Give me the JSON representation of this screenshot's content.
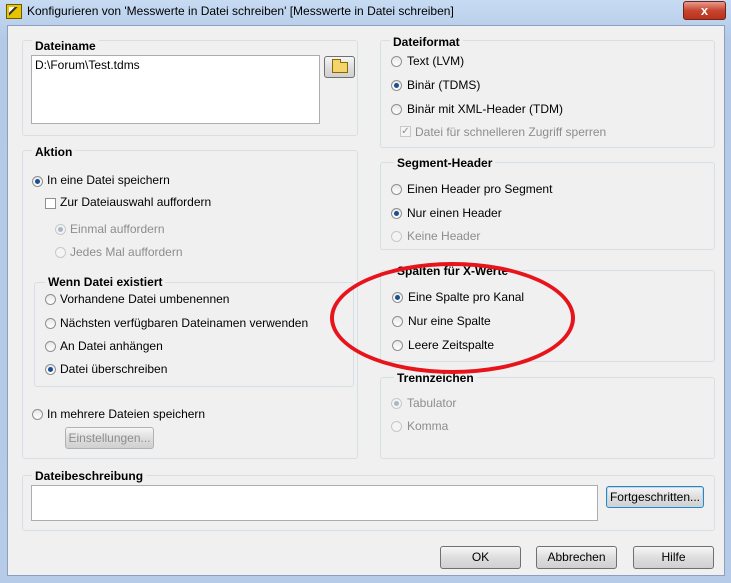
{
  "window": {
    "title": "Konfigurieren von 'Messwerte in Datei schreiben' [Messwerte in Datei schreiben]",
    "close_symbol": "x"
  },
  "dateiname": {
    "label": "Dateiname",
    "value": "D:\\Forum\\Test.tdms"
  },
  "aktion": {
    "label": "Aktion",
    "single_file": "In eine Datei speichern",
    "ask_checkbox": "Zur Dateiauswahl auffordern",
    "ask_once": "Einmal auffordern",
    "ask_each": "Jedes Mal auffordern",
    "multi_files": "In mehrere Dateien speichern",
    "settings_button": "Einstellungen..."
  },
  "wenn_datei": {
    "label": "Wenn Datei existiert",
    "options": [
      "Vorhandene Datei umbenennen",
      "Nächsten verfügbaren Dateinamen verwenden",
      "An Datei anhängen",
      "Datei überschreiben"
    ]
  },
  "dateiformat": {
    "label": "Dateiformat",
    "options": [
      "Text (LVM)",
      "Binär (TDMS)",
      "Binär mit XML-Header (TDM)"
    ],
    "lock_checkbox": "Datei für schnelleren Zugriff sperren",
    "check_mark": "✓"
  },
  "segment_header": {
    "label": "Segment-Header",
    "options": [
      "Einen Header pro Segment",
      "Nur einen Header",
      "Keine Header"
    ]
  },
  "spalten": {
    "label": "Spalten für X-Werte",
    "options": [
      "Eine Spalte pro Kanal",
      "Nur eine Spalte",
      "Leere Zeitspalte"
    ]
  },
  "trennzeichen": {
    "label": "Trennzeichen",
    "options": [
      "Tabulator",
      "Komma"
    ]
  },
  "beschreibung": {
    "label": "Dateibeschreibung",
    "value": "",
    "advanced_button": "Fortgeschritten..."
  },
  "footer": {
    "ok": "OK",
    "cancel": "Abbrechen",
    "help": "Hilfe"
  },
  "colors": {
    "annotation": "#e8141c",
    "title_bar": "#b9cfea"
  }
}
